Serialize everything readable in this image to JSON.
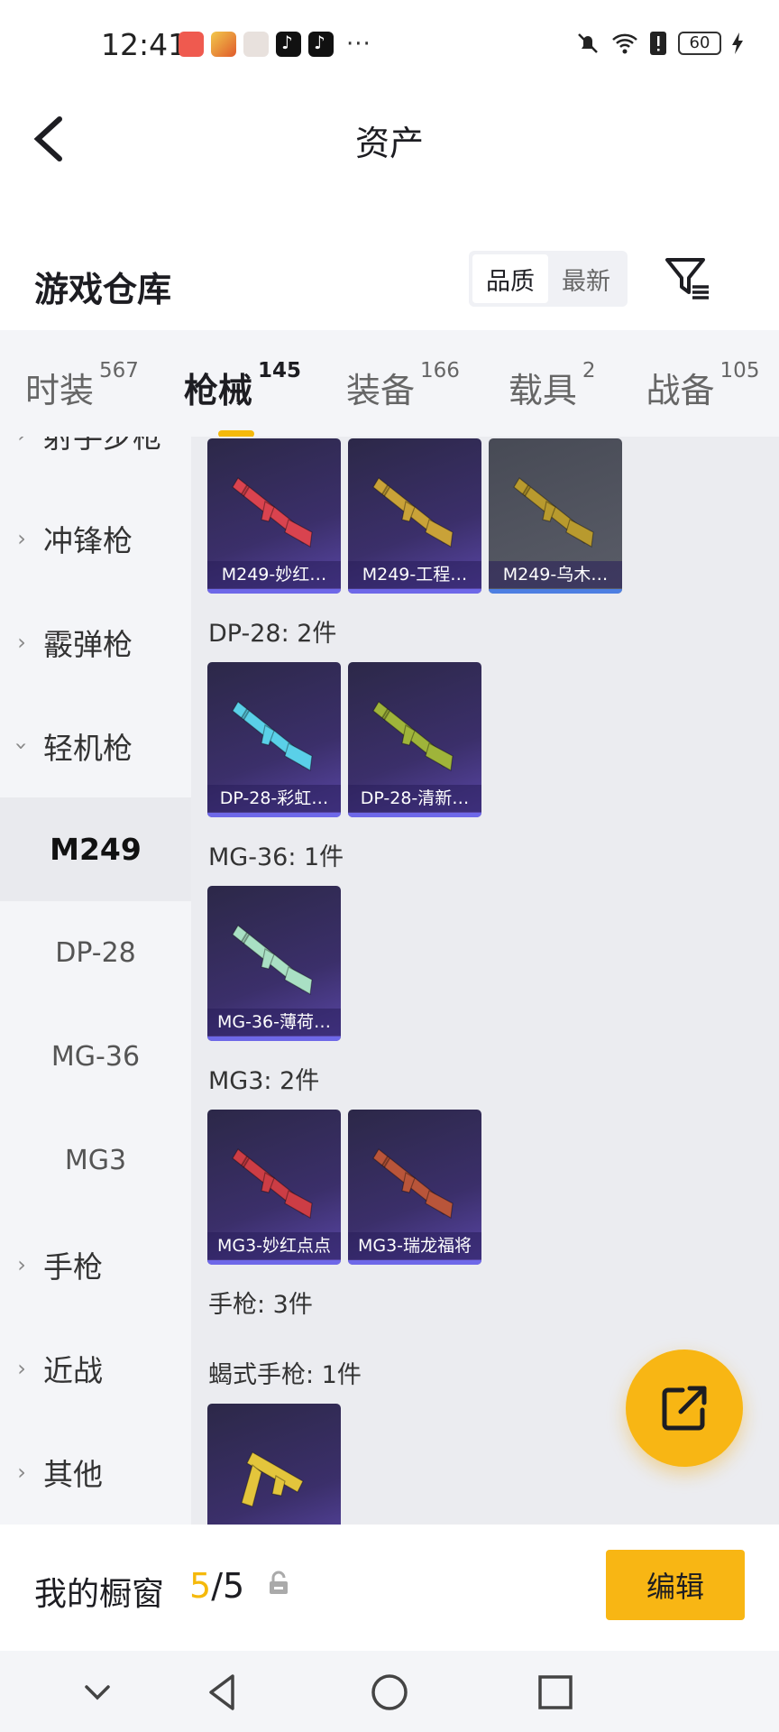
{
  "status_bar": {
    "time": "12:41",
    "more": "···",
    "battery": "60"
  },
  "header": {
    "title": "资产"
  },
  "section": {
    "title": "游戏仓库",
    "sort_options": [
      "品质",
      "最新"
    ],
    "active_sort": "品质"
  },
  "tabs": [
    {
      "label": "时装",
      "count": "567"
    },
    {
      "label": "枪械",
      "count": "145",
      "active": true
    },
    {
      "label": "装备",
      "count": "166"
    },
    {
      "label": "载具",
      "count": "2"
    },
    {
      "label": "战备",
      "count": "105"
    }
  ],
  "sidebar": {
    "items": [
      {
        "label": "射手步枪"
      },
      {
        "label": "冲锋枪"
      },
      {
        "label": "霰弹枪"
      },
      {
        "label": "轻机枪",
        "expanded": true
      },
      {
        "label": "手枪"
      },
      {
        "label": "近战"
      },
      {
        "label": "其他"
      }
    ],
    "subitems": [
      {
        "label": "M249",
        "active": true
      },
      {
        "label": "DP-28"
      },
      {
        "label": "MG-36"
      },
      {
        "label": "MG3"
      }
    ]
  },
  "content": {
    "groups": [
      {
        "label": "DP-28: 2件"
      },
      {
        "label": "MG-36: 1件"
      },
      {
        "label": "MG3: 2件"
      },
      {
        "label": "手枪: 3件"
      },
      {
        "label": "蝎式手枪: 1件"
      }
    ],
    "cards": [
      {
        "name": "M249-妙红…",
        "gun_color": "#d9434f"
      },
      {
        "name": "M249-工程…",
        "gun_color": "#c9a238"
      },
      {
        "name": "M249-乌木…",
        "gun_color": "#b89a2e"
      },
      {
        "name": "DP-28-彩虹…",
        "gun_color": "#5ad0e8"
      },
      {
        "name": "DP-28-清新…",
        "gun_color": "#9fb43a"
      },
      {
        "name": "MG-36-薄荷…",
        "gun_color": "#a9e0c4"
      },
      {
        "name": "MG3-妙红点点",
        "gun_color": "#cc3d45"
      },
      {
        "name": "MG3-瑞龙福将",
        "gun_color": "#b9553a"
      },
      {
        "name": "",
        "gun_color": "#e3c53c"
      }
    ]
  },
  "showcase": {
    "label": "我的橱窗",
    "current": "5",
    "total": "/5",
    "edit_label": "编辑"
  },
  "colors": {
    "accent": "#f8b614",
    "card_purple": "#3b2f6a"
  }
}
